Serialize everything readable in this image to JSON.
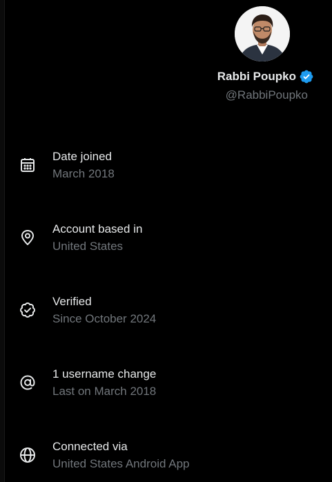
{
  "profile": {
    "display_name": "Rabbi Poupko",
    "handle": "@RabbiPoupko",
    "verified_color": "#1d9bf0"
  },
  "about": {
    "items": [
      {
        "icon": "calendar-icon",
        "label": "Date joined",
        "value": "March 2018"
      },
      {
        "icon": "location-pin-icon",
        "label": "Account based in",
        "value": "United States"
      },
      {
        "icon": "verified-check-icon",
        "label": "Verified",
        "value": "Since October 2024"
      },
      {
        "icon": "at-sign-icon",
        "label": "1 username change",
        "value": "Last on March 2018"
      },
      {
        "icon": "globe-icon",
        "label": "Connected via",
        "value": "United States Android App"
      }
    ]
  },
  "theme": {
    "background": "#000000",
    "primary_text": "#e7e9ea",
    "secondary_text": "#71767b"
  }
}
